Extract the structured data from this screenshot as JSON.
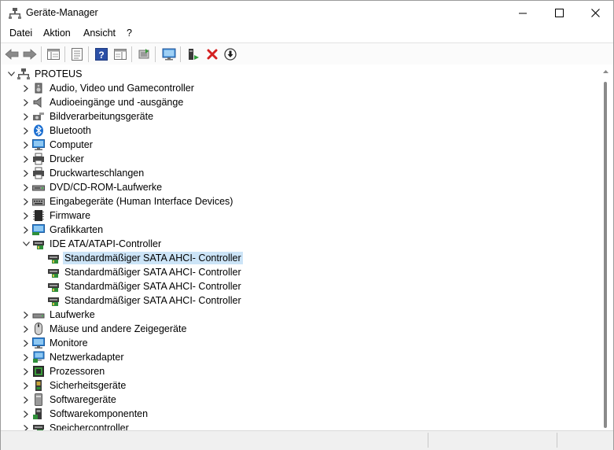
{
  "window": {
    "title": "Geräte-Manager"
  },
  "menu": {
    "items": [
      {
        "label": "Datei"
      },
      {
        "label": "Aktion"
      },
      {
        "label": "Ansicht"
      },
      {
        "label": "?"
      }
    ]
  },
  "toolbar": {
    "buttons": [
      {
        "icon": "back-arrow-icon"
      },
      {
        "icon": "forward-arrow-icon"
      },
      {
        "icon": "show-hide-console-tree-icon"
      },
      {
        "icon": "properties-icon"
      },
      {
        "icon": "help-icon"
      },
      {
        "icon": "action-pane-icon"
      },
      {
        "icon": "update-driver-icon"
      },
      {
        "icon": "scan-hardware-icon"
      },
      {
        "icon": "enable-device-icon"
      },
      {
        "icon": "uninstall-device-icon"
      },
      {
        "icon": "disable-device-icon"
      }
    ]
  },
  "tree": {
    "root": {
      "label": "PROTEUS"
    },
    "categories": [
      {
        "label": "Audio, Video und Gamecontroller",
        "icon": "speaker-icon"
      },
      {
        "label": "Audioeingänge und -ausgänge",
        "icon": "speaker-icon"
      },
      {
        "label": "Bildverarbeitungsgeräte",
        "icon": "camera-icon"
      },
      {
        "label": "Bluetooth",
        "icon": "bluetooth-icon"
      },
      {
        "label": "Computer",
        "icon": "monitor-icon"
      },
      {
        "label": "Drucker",
        "icon": "printer-icon"
      },
      {
        "label": "Druckwarteschlangen",
        "icon": "printer-icon"
      },
      {
        "label": "DVD/CD-ROM-Laufwerke",
        "icon": "dvd-drive-icon"
      },
      {
        "label": "Eingabegeräte (Human Interface Devices)",
        "icon": "hid-icon"
      },
      {
        "label": "Firmware",
        "icon": "firmware-icon"
      },
      {
        "label": "Grafikkarten",
        "icon": "display-adapter-icon"
      },
      {
        "label": "IDE ATA/ATAPI-Controller",
        "icon": "storage-controller-icon",
        "expanded": true,
        "children": [
          {
            "label": "Standardmäßiger SATA AHCI- Controller",
            "selected": true
          },
          {
            "label": "Standardmäßiger SATA AHCI- Controller"
          },
          {
            "label": "Standardmäßiger SATA AHCI- Controller"
          },
          {
            "label": "Standardmäßiger SATA AHCI- Controller"
          }
        ]
      },
      {
        "label": "Laufwerke",
        "icon": "disk-drive-icon"
      },
      {
        "label": "Mäuse und andere Zeigegeräte",
        "icon": "mouse-icon"
      },
      {
        "label": "Monitore",
        "icon": "monitor-icon"
      },
      {
        "label": "Netzwerkadapter",
        "icon": "network-adapter-icon"
      },
      {
        "label": "Prozessoren",
        "icon": "processor-icon"
      },
      {
        "label": "Sicherheitsgeräte",
        "icon": "security-device-icon"
      },
      {
        "label": "Softwaregeräte",
        "icon": "software-device-icon"
      },
      {
        "label": "Softwarekomponenten",
        "icon": "software-component-icon"
      },
      {
        "label": "Speichercontroller",
        "icon": "storage-controller-icon"
      }
    ]
  }
}
